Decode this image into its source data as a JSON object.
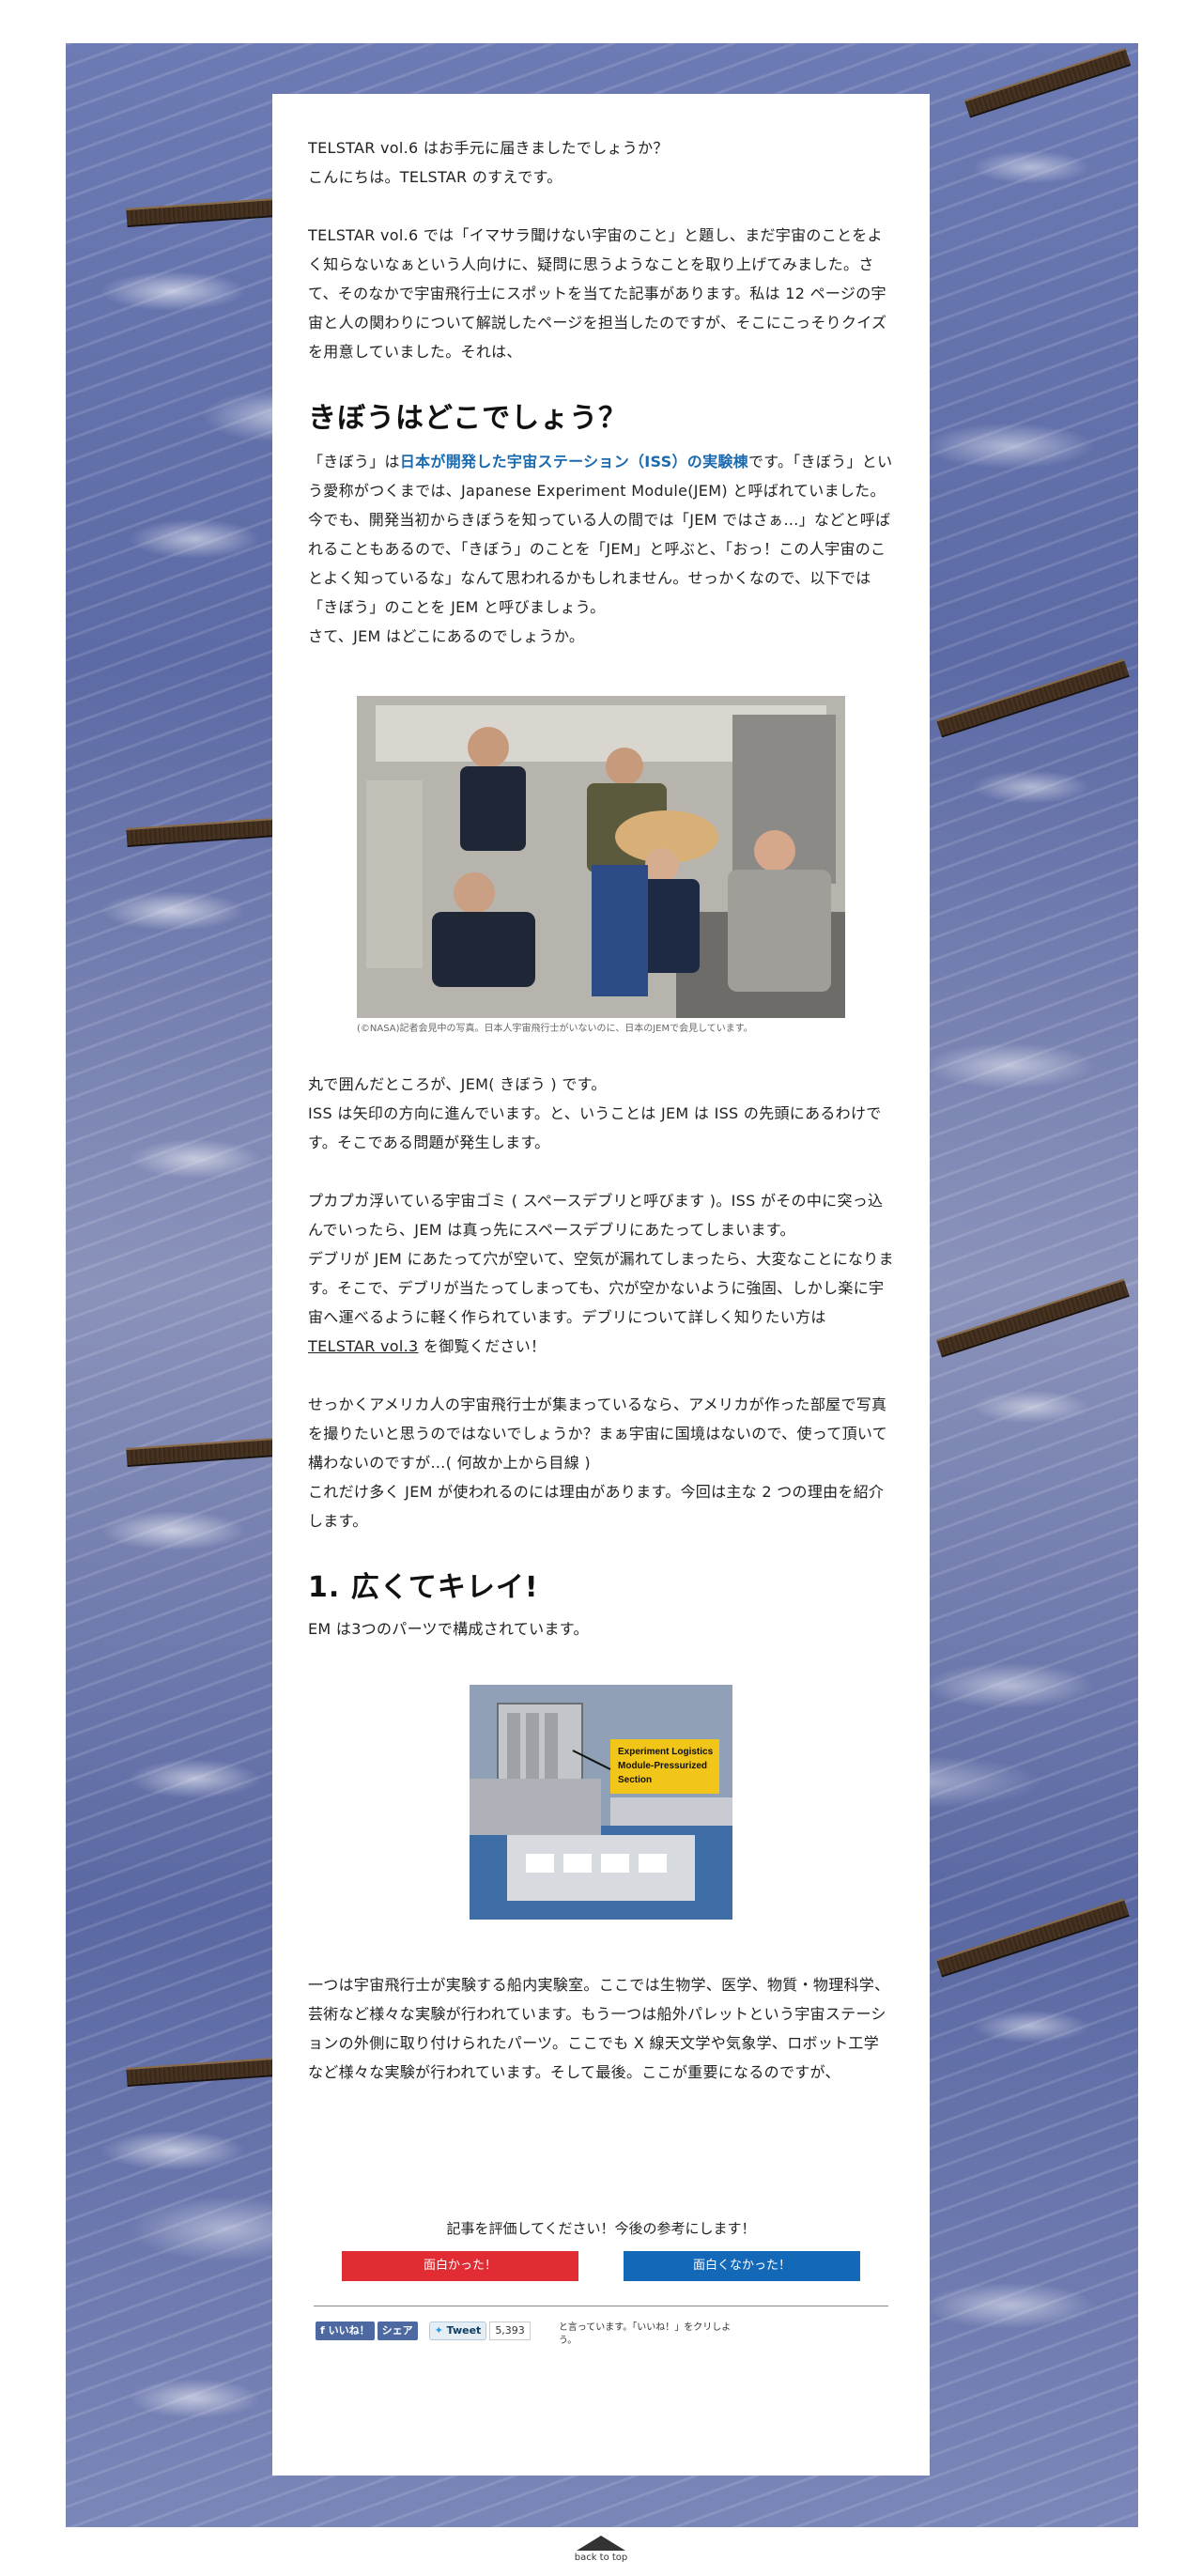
{
  "intro": {
    "line1": "TELSTAR vol.6 はお手元に届きましたでしょうか？",
    "line2": "こんにちは。TELSTAR のすえです。",
    "para": "TELSTAR vol.6 では「イマサラ聞けない宇宙のこと」と題し、まだ宇宙のことをよく知らないなぁという人向けに、疑問に思うようなことを取り上げてみました。さて、そのなかで宇宙飛行士にスポットを当てた記事があります。私は 12 ページの宇宙と人の関わりについて解説したページを担当したのですが、そこにこっそりクイズを用意していました。それは、"
  },
  "section1": {
    "heading": "きぼうはどこでしょう？",
    "p_start": "「きぼう」は",
    "p_link": "日本が開発した宇宙ステーション（ISS）の実験棟",
    "p_rest": "です。「きぼう」という愛称がつくまでは、Japanese Experiment Module(JEM) と呼ばれていました。今でも、開発当初からきぼうを知っている人の間では「JEM ではさぁ…」などと呼ばれることもあるので、「きぼう」のことを「JEM」と呼ぶと、「おっ！この人宇宙のことよく知っているな」なんて思われるかもしれません。せっかくなので、以下では「きぼう」のことを JEM と呼びましょう。",
    "p_last": "さて、JEM はどこにあるのでしょうか。"
  },
  "photo": {
    "caption": "(©NASA)記者会見中の写真。日本人宇宙飛行士がいないのに、日本のJEMで会見しています。"
  },
  "section1b": {
    "p1": "丸で囲んだところが、JEM( きぼう ) です。",
    "p2": "ISS は矢印の方向に進んでいます。と、いうことは JEM は ISS の先頭にあるわけです。そこである問題が発生します。",
    "p3": "プカプカ浮いている宇宙ゴミ ( スペースデブリと呼びます )。ISS がその中に突っ込んでいったら、JEM は真っ先にスペースデブリにあたってしまいます。",
    "p4_start": "デブリが JEM にあたって穴が空いて、空気が漏れてしまったら、大変なことになります。そこで、デブリが当たってしまっても、穴が空かないように強固、しかし楽に宇宙へ運べるように軽く作られています。デブリについて詳しく知りたい方は ",
    "p4_link": "TELSTAR vol.3",
    "p4_end": " を御覧ください！",
    "p5": "せっかくアメリカ人の宇宙飛行士が集まっているなら、アメリカが作った部屋で写真を撮りたいと思うのではないでしょうか？まぁ宇宙に国境はないので、使って頂いて構わないのですが…( 何故か上から目線 )",
    "p6": "これだけ多く JEM が使われるのには理由があります。今回は主な 2 つの理由を紹介します。"
  },
  "section2": {
    "heading": "1. 広くてキレイ!",
    "p1": "EM は3つのパーツで構成されています。",
    "figure_label_l1": "Experiment Logistics",
    "figure_label_l2": "Module-Pressurized",
    "figure_label_l3": "Section",
    "p2": "一つは宇宙飛行士が実験する船内実験室。ここでは生物学、医学、物質・物理科学、芸術など様々な実験が行われています。もう一つは船外パレットという宇宙ステーションの外側に取り付けられたパーツ。ここでも X 線天文学や気象学、ロボット工学など様々な実験が行われています。そして最後。ここが重要になるのですが、"
  },
  "rating": {
    "title": "記事を評価してください！今後の参考にします！",
    "good_label": "面白かった！",
    "bad_label": "面白くなかった！"
  },
  "social": {
    "like_label": "いいね！",
    "share_label": "シェア",
    "tweet_label": "Tweet",
    "tweet_count": "5,393",
    "fb_note": "と言っています。「いいね！」をクリしよう。"
  },
  "footer": {
    "back_to_top": "back to top"
  },
  "colors": {
    "link_blue": "#1a6ab0",
    "good_red": "#e12c33",
    "bad_blue": "#1468b8"
  }
}
